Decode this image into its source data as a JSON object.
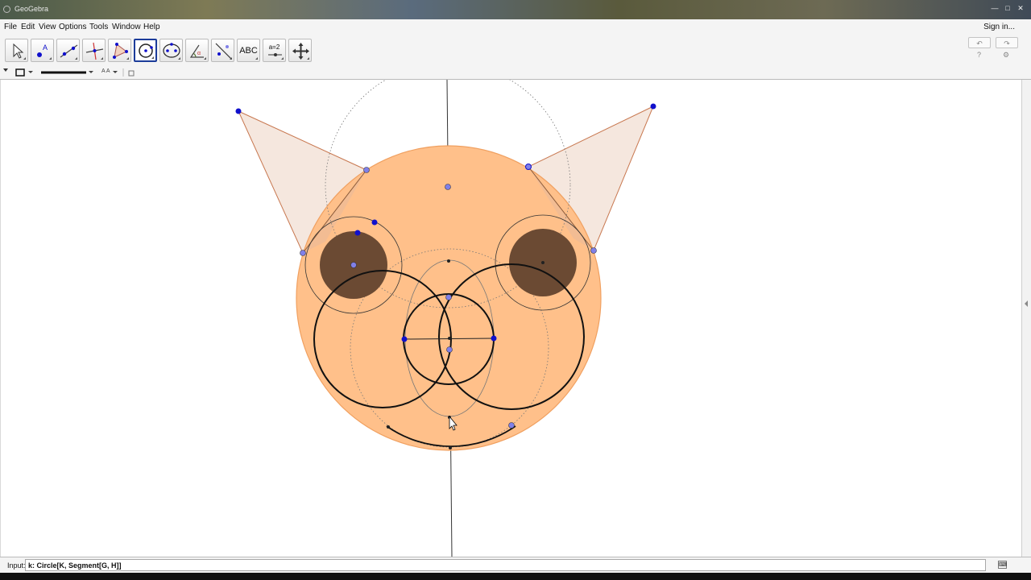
{
  "window": {
    "title": "GeoGebra",
    "controls": [
      "—",
      "□",
      "✕"
    ]
  },
  "menu": {
    "items": [
      "File",
      "Edit",
      "View",
      "Options",
      "Tools",
      "Window",
      "Help"
    ],
    "signin": "Sign in..."
  },
  "toolbar": {
    "tools": [
      {
        "name": "move-tool",
        "icon": "arrow-icon",
        "label": "",
        "selected": false
      },
      {
        "name": "point-tool",
        "icon": "point-icon",
        "label": "",
        "selected": false
      },
      {
        "name": "line-tool",
        "icon": "line-icon",
        "label": "",
        "selected": false
      },
      {
        "name": "perpendicular-line-tool",
        "icon": "perpendicular-icon",
        "label": "",
        "selected": false
      },
      {
        "name": "polygon-tool",
        "icon": "polygon-icon",
        "label": "",
        "selected": false
      },
      {
        "name": "circle-tool",
        "icon": "circle-icon",
        "label": "",
        "selected": true
      },
      {
        "name": "ellipse-tool",
        "icon": "ellipse-icon",
        "label": "",
        "selected": false
      },
      {
        "name": "angle-tool",
        "icon": "angle-icon",
        "label": "",
        "selected": false
      },
      {
        "name": "reflect-tool",
        "icon": "reflect-icon",
        "label": "",
        "selected": false
      },
      {
        "name": "text-tool",
        "icon": "text-icon",
        "label": "ABC",
        "selected": false
      },
      {
        "name": "slider-tool",
        "icon": "slider-icon",
        "label": "a=2",
        "selected": false
      },
      {
        "name": "move-graphics-tool",
        "icon": "move-graphics-icon",
        "label": "",
        "selected": false
      }
    ],
    "undo_label": "↶",
    "redo_label": "↷",
    "help_label": "?",
    "settings_label": "⚙"
  },
  "stylebar": {
    "font_size_label": "A A"
  },
  "input": {
    "label": "Input:",
    "value": "k: Circle[K, Segment[G, H]]"
  },
  "colors": {
    "face_fill": "#ffc08a",
    "face_stroke": "#f0a060",
    "eye_fill": "#6b4a33",
    "ear_fill": "#f3e3d8",
    "point_blue": "#1010cc",
    "point_light": "#8080e8"
  }
}
